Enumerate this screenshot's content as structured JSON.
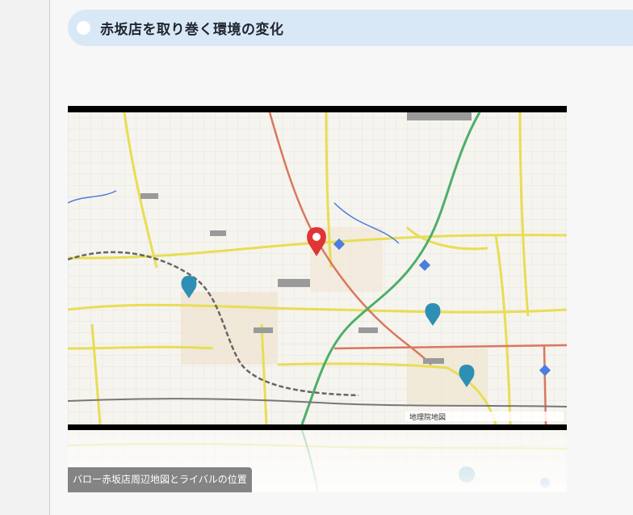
{
  "section": {
    "heading": "赤坂店を取り巻く環境の変化"
  },
  "figure": {
    "caption": "バロー赤坂店周辺地図とライバルの位置",
    "alt": "",
    "map_credit": "地理院地図"
  },
  "colors": {
    "heading_bg": "#d9e8f6",
    "heading_text": "#1f2430",
    "main_pin": "#e03535",
    "rival_pin": "#2e8fb5",
    "road_yellow": "#e8dd55",
    "rail_green": "#4caf6a",
    "road_red": "#d9775f",
    "water_blue": "#4a7ee0"
  },
  "icons": {
    "main_pin": "map-pin-icon",
    "rival_pin": "map-pin-icon",
    "heading_marker": "circle-icon"
  }
}
